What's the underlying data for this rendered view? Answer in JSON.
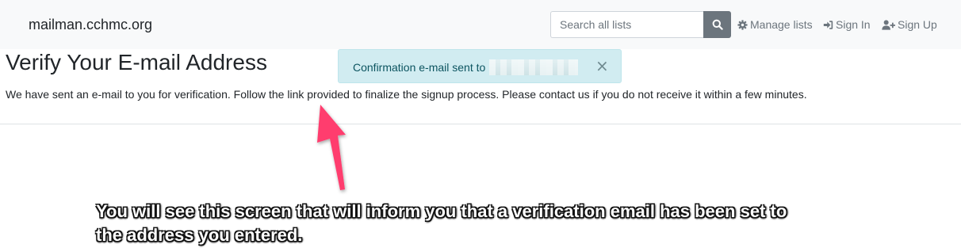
{
  "navbar": {
    "brand": "mailman.cchmc.org",
    "search": {
      "placeholder": "Search all lists"
    },
    "links": {
      "manage_lists": "Manage lists",
      "sign_in": "Sign In",
      "sign_up": "Sign Up"
    }
  },
  "alert": {
    "message": "Confirmation e-mail sent to",
    "close_symbol": "×",
    "variant_color": "#d1ecf1"
  },
  "main": {
    "title": "Verify Your E-mail Address",
    "body": "We have sent an e-mail to you for verification. Follow the link provided to finalize the signup process. Please contact us if you do not receive it within a few minutes."
  },
  "annotation": {
    "text": "You will see this screen that will inform you that a verification email has been set to the address you entered.",
    "arrow_color": "#ff3d6e"
  },
  "icons": [
    "search-icon",
    "gear-icon",
    "sign-in-icon",
    "user-plus-icon",
    "close-icon",
    "arrow-annotation"
  ]
}
